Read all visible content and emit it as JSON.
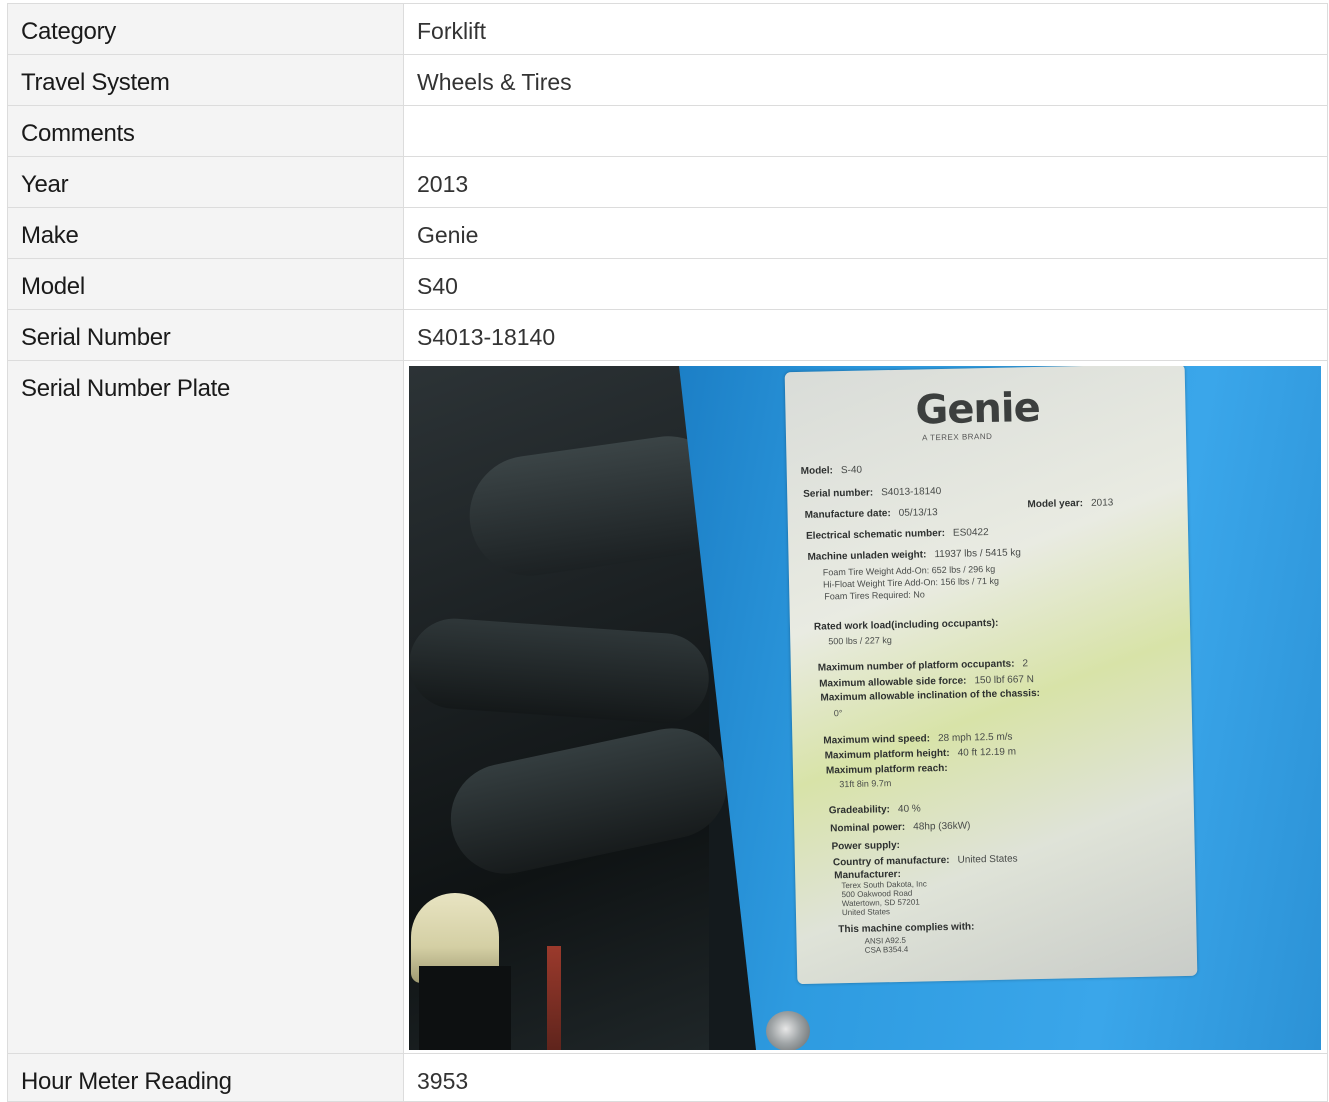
{
  "rows": [
    {
      "label": "Category",
      "value": "Forklift"
    },
    {
      "label": "Travel System",
      "value": "Wheels & Tires"
    },
    {
      "label": "Comments",
      "value": ""
    },
    {
      "label": "Year",
      "value": "2013"
    },
    {
      "label": "Make",
      "value": "Genie"
    },
    {
      "label": "Model",
      "value": "S40"
    },
    {
      "label": "Serial Number",
      "value": "S4013-18140"
    }
  ],
  "photo_row": {
    "label": "Serial Number Plate"
  },
  "last_row": {
    "label": "Hour Meter Reading",
    "value": "3953"
  },
  "plate": {
    "logo": "Genie",
    "brand": "A TEREX BRAND",
    "model_label": "Model:",
    "model_value": "S-40",
    "serial_label": "Serial number:",
    "serial_value": "S4013-18140",
    "mfg_date_label": "Manufacture date:",
    "mfg_date_value": "05/13/13",
    "model_year_label": "Model year:",
    "model_year_value": "2013",
    "schematic_label": "Electrical schematic number:",
    "schematic_value": "ES0422",
    "weight_label": "Machine unladen weight:",
    "weight_value": "11937 lbs / 5415 kg",
    "foam_addon": "Foam Tire Weight Add-On: 652 lbs / 296 kg",
    "hifloat_addon": "Hi-Float Weight Tire Add-On: 156 lbs / 71 kg",
    "foam_required": "Foam Tires Required: No",
    "load_label": "Rated work load(including occupants):",
    "load_value": "500 lbs / 227 kg",
    "occupants_label": "Maximum number of platform occupants:",
    "occupants_value": "2",
    "side_force_label": "Maximum allowable side force:",
    "side_force_value": "150 lbf 667 N",
    "incline_label": "Maximum allowable inclination of the chassis:",
    "incline_value": "0°",
    "wind_label": "Maximum wind speed:",
    "wind_value": "28 mph     12.5 m/s",
    "height_label": "Maximum platform height:",
    "height_value": "40 ft     12.19 m",
    "reach_label": "Maximum platform reach:",
    "reach_value": "31ft 8in   9.7m",
    "grade_label": "Gradeability:",
    "grade_value": "40 %",
    "power_label": "Nominal power:",
    "power_value": "48hp (36kW)",
    "supply_label": "Power supply:",
    "country_label": "Country of manufacture:",
    "country_value": "United States",
    "manufacturer_label": "Manufacturer:",
    "mfr_line1": "Terex South Dakota, Inc",
    "mfr_line2": "500 Oakwood Road",
    "mfr_line3": "Watertown, SD 57201",
    "mfr_line4": "United States",
    "complies_label": "This machine complies with:",
    "std1": "ANSI A92.5",
    "std2": "CSA B354.4"
  },
  "colors": {
    "label_bg": "#f4f4f4",
    "border": "#dcdcdc",
    "panel_blue": "#2e9be0"
  }
}
